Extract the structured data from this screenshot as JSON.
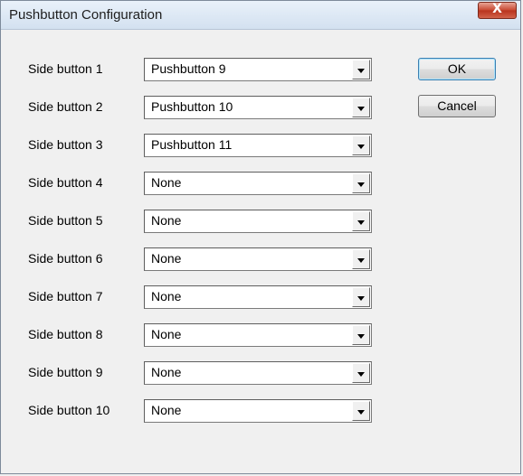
{
  "window": {
    "title": "Pushbutton Configuration",
    "close_label": "X"
  },
  "buttons": {
    "ok_label": "OK",
    "cancel_label": "Cancel"
  },
  "rows": [
    {
      "label": "Side button 1",
      "value": "Pushbutton 9"
    },
    {
      "label": "Side button 2",
      "value": "Pushbutton 10"
    },
    {
      "label": "Side button 3",
      "value": "Pushbutton 11"
    },
    {
      "label": "Side button 4",
      "value": "None"
    },
    {
      "label": "Side button 5",
      "value": "None"
    },
    {
      "label": "Side button 6",
      "value": "None"
    },
    {
      "label": "Side button 7",
      "value": "None"
    },
    {
      "label": "Side button 8",
      "value": "None"
    },
    {
      "label": "Side button 9",
      "value": "None"
    },
    {
      "label": "Side button 10",
      "value": "None"
    }
  ]
}
